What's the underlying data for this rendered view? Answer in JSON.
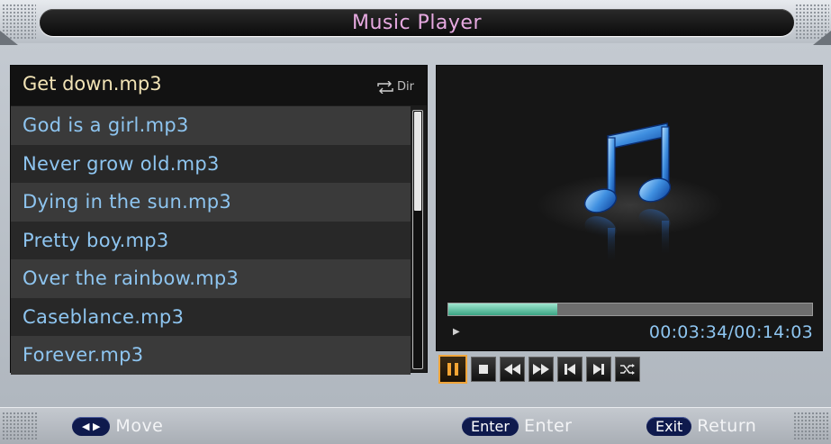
{
  "title_bar": {
    "title": "Music Player"
  },
  "playlist": {
    "current": "Get down.mp3",
    "mode_label": "Dir",
    "mode_icon": "repeat-icon",
    "items": [
      "God is a girl.mp3",
      "Never grow old.mp3",
      "Dying in the sun.mp3",
      "Pretty boy.mp3",
      "Over the rainbow.mp3",
      "Caseblance.mp3",
      "Forever.mp3"
    ]
  },
  "preview": {
    "icon": "music-note-icon",
    "progress_fraction": 0.3,
    "time": "00:03:34/00:14:03",
    "state_indicator": "▶"
  },
  "controls": [
    {
      "name": "pause",
      "icon": "pause-icon",
      "active": true
    },
    {
      "name": "stop",
      "icon": "stop-icon",
      "active": false
    },
    {
      "name": "rewind",
      "icon": "rewind-icon",
      "active": false
    },
    {
      "name": "fast-forward",
      "icon": "fast-forward-icon",
      "active": false
    },
    {
      "name": "previous",
      "icon": "skip-previous-icon",
      "active": false
    },
    {
      "name": "next",
      "icon": "skip-next-icon",
      "active": false
    },
    {
      "name": "shuffle",
      "icon": "shuffle-icon",
      "active": false
    }
  ],
  "bottom_bar": {
    "move": {
      "key": "◀ ▶",
      "label": "Move"
    },
    "enter": {
      "key": "Enter",
      "label": "Enter"
    },
    "exit": {
      "key": "Exit",
      "label": "Return"
    }
  },
  "colors": {
    "accent_active": "#f0a53a",
    "list_text": "#8ec5f0",
    "selected_text": "#f1e3b5",
    "title_text": "#e6a9e0",
    "progress": "#3aa483"
  }
}
